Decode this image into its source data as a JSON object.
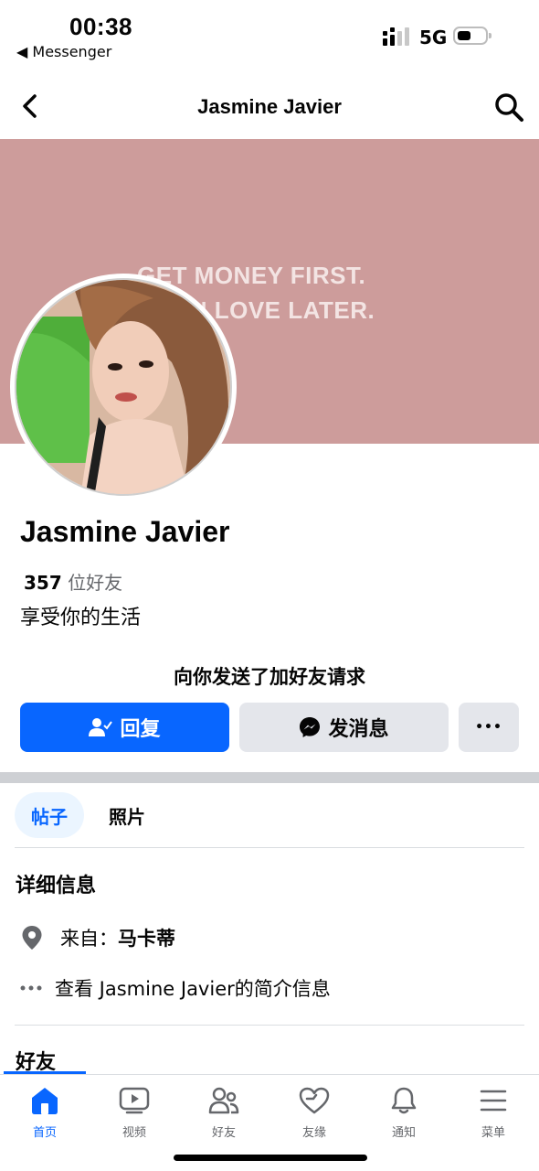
{
  "status": {
    "time": "00:38",
    "back_app": "◀ Messenger",
    "network": "5G"
  },
  "header": {
    "title": "Jasmine Javier"
  },
  "cover": {
    "line1": "GET MONEY FIRST.",
    "line2": "IN LOVE LATER.",
    "color": "#cd9c9b"
  },
  "profile": {
    "name": "Jasmine Javier",
    "friend_count": "357",
    "friend_unit": "位好友",
    "bio": "享受你的生活"
  },
  "request": {
    "text": "向你发送了加好友请求",
    "reply_label": "回复",
    "message_label": "发消息",
    "more_label": "•••"
  },
  "tabs": [
    {
      "label": "帖子",
      "active": true
    },
    {
      "label": "照片",
      "active": false
    }
  ],
  "details": {
    "title": "详细信息",
    "from_label": "来自：",
    "from_value": "马卡蒂",
    "about_link": "查看 Jasmine Javier的简介信息"
  },
  "friends_section": {
    "title": "好友"
  },
  "bottom_nav": [
    {
      "label": "首页",
      "icon": "home-icon",
      "active": true
    },
    {
      "label": "视频",
      "icon": "video-icon",
      "active": false
    },
    {
      "label": "好友",
      "icon": "friends-icon",
      "active": false
    },
    {
      "label": "友缘",
      "icon": "dating-heart-icon",
      "active": false
    },
    {
      "label": "通知",
      "icon": "bell-icon",
      "active": false
    },
    {
      "label": "菜单",
      "icon": "menu-icon",
      "active": false
    }
  ],
  "colors": {
    "accent": "#0866ff",
    "button_gray": "#e4e6eb"
  }
}
